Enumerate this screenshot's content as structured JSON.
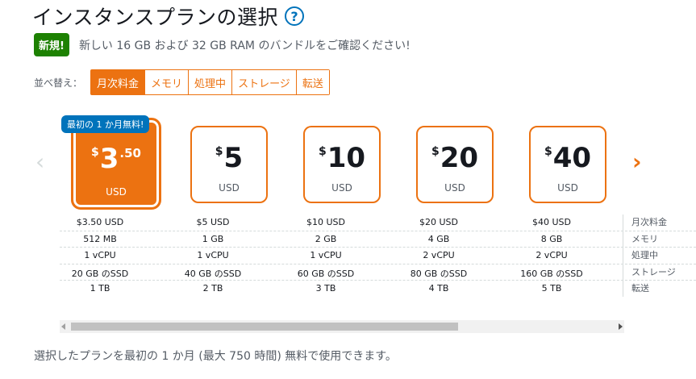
{
  "header": {
    "title": "インスタンスプランの選択",
    "help_icon": "?"
  },
  "banner": {
    "badge": "新規!",
    "text": "新しい 16 GB および 32 GB RAM のバンドルをご確認ください!"
  },
  "sort": {
    "label": "並べ替え：",
    "options": [
      "月次料金",
      "メモリ",
      "処理中",
      "ストレージ",
      "転送"
    ],
    "active": "月次料金"
  },
  "carousel": {
    "prev_icon": "chevron-left-icon",
    "next_icon": "chevron-right-icon"
  },
  "promo_badge": "最初の 1 か月無料!",
  "plans": [
    {
      "dollar": "$",
      "amount": "3",
      "cents": ".50",
      "currency": "USD",
      "selected": true
    },
    {
      "dollar": "$",
      "amount": "5",
      "cents": "",
      "currency": "USD",
      "selected": false
    },
    {
      "dollar": "$",
      "amount": "10",
      "cents": "",
      "currency": "USD",
      "selected": false
    },
    {
      "dollar": "$",
      "amount": "20",
      "cents": "",
      "currency": "USD",
      "selected": false
    },
    {
      "dollar": "$",
      "amount": "40",
      "cents": "",
      "currency": "USD",
      "selected": false
    }
  ],
  "specs": {
    "labels": [
      "月次料金",
      "メモリ",
      "処理中",
      "ストレージ",
      "転送"
    ],
    "price": [
      "$3.50 USD",
      "$5 USD",
      "$10 USD",
      "$20 USD",
      "$40 USD"
    ],
    "memory": [
      "512 MB",
      "1 GB",
      "2 GB",
      "4 GB",
      "8 GB"
    ],
    "cpu": [
      "1 vCPU",
      "1 vCPU",
      "1 vCPU",
      "2 vCPU",
      "2 vCPU"
    ],
    "storage": [
      "20 GB のSSD",
      "40 GB のSSD",
      "60 GB のSSD",
      "80 GB のSSD",
      "160 GB のSSD"
    ],
    "transfer": [
      "1 TB",
      "2 TB",
      "3 TB",
      "4 TB",
      "5 TB"
    ]
  },
  "footer": {
    "text": "選択したプランを最初の 1 か月 (最大 750 時間) 無料で使用できます。"
  },
  "colors": {
    "accent": "#ec7211",
    "new_badge": "#1d8102",
    "promo_badge": "#0073bb"
  }
}
